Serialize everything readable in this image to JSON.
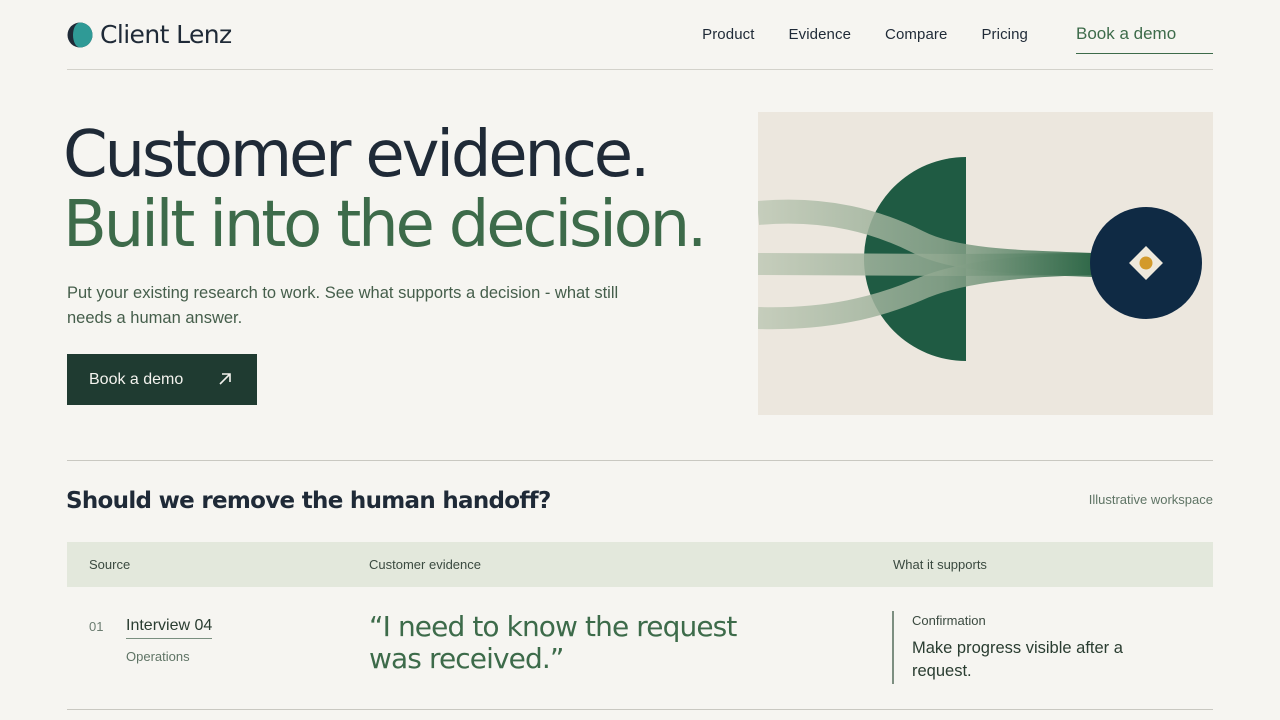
{
  "brand": {
    "name": "Client Lenz"
  },
  "nav": {
    "links": [
      "Product",
      "Evidence",
      "Compare",
      "Pricing"
    ],
    "cta": "Book a demo"
  },
  "hero": {
    "line1": "Customer evidence.",
    "line2": "Built into the decision.",
    "subtitle": "Put your existing research to work. See what supports a decision - what still needs a human answer.",
    "button": "Book a demo"
  },
  "workspace": {
    "title": "Should we remove the human handoff?",
    "tag": "Illustrative workspace",
    "columns": [
      "Source",
      "Customer evidence",
      "What it supports"
    ],
    "rows": [
      {
        "num": "01",
        "source": "Interview 04",
        "dept": "Operations",
        "quote": "“I need to know the request was received.”",
        "support_label": "Confirmation",
        "support_text": "Make progress visible after a request."
      }
    ]
  },
  "colors": {
    "background": "#f6f5f1",
    "ink": "#1f2a37",
    "accent_green": "#3d6b4a",
    "button_dark": "#1f3b31",
    "navy": "#0f2a44",
    "gold": "#d39a2b"
  },
  "icons": [
    "logo-mark-icon",
    "arrow-up-right-icon"
  ]
}
